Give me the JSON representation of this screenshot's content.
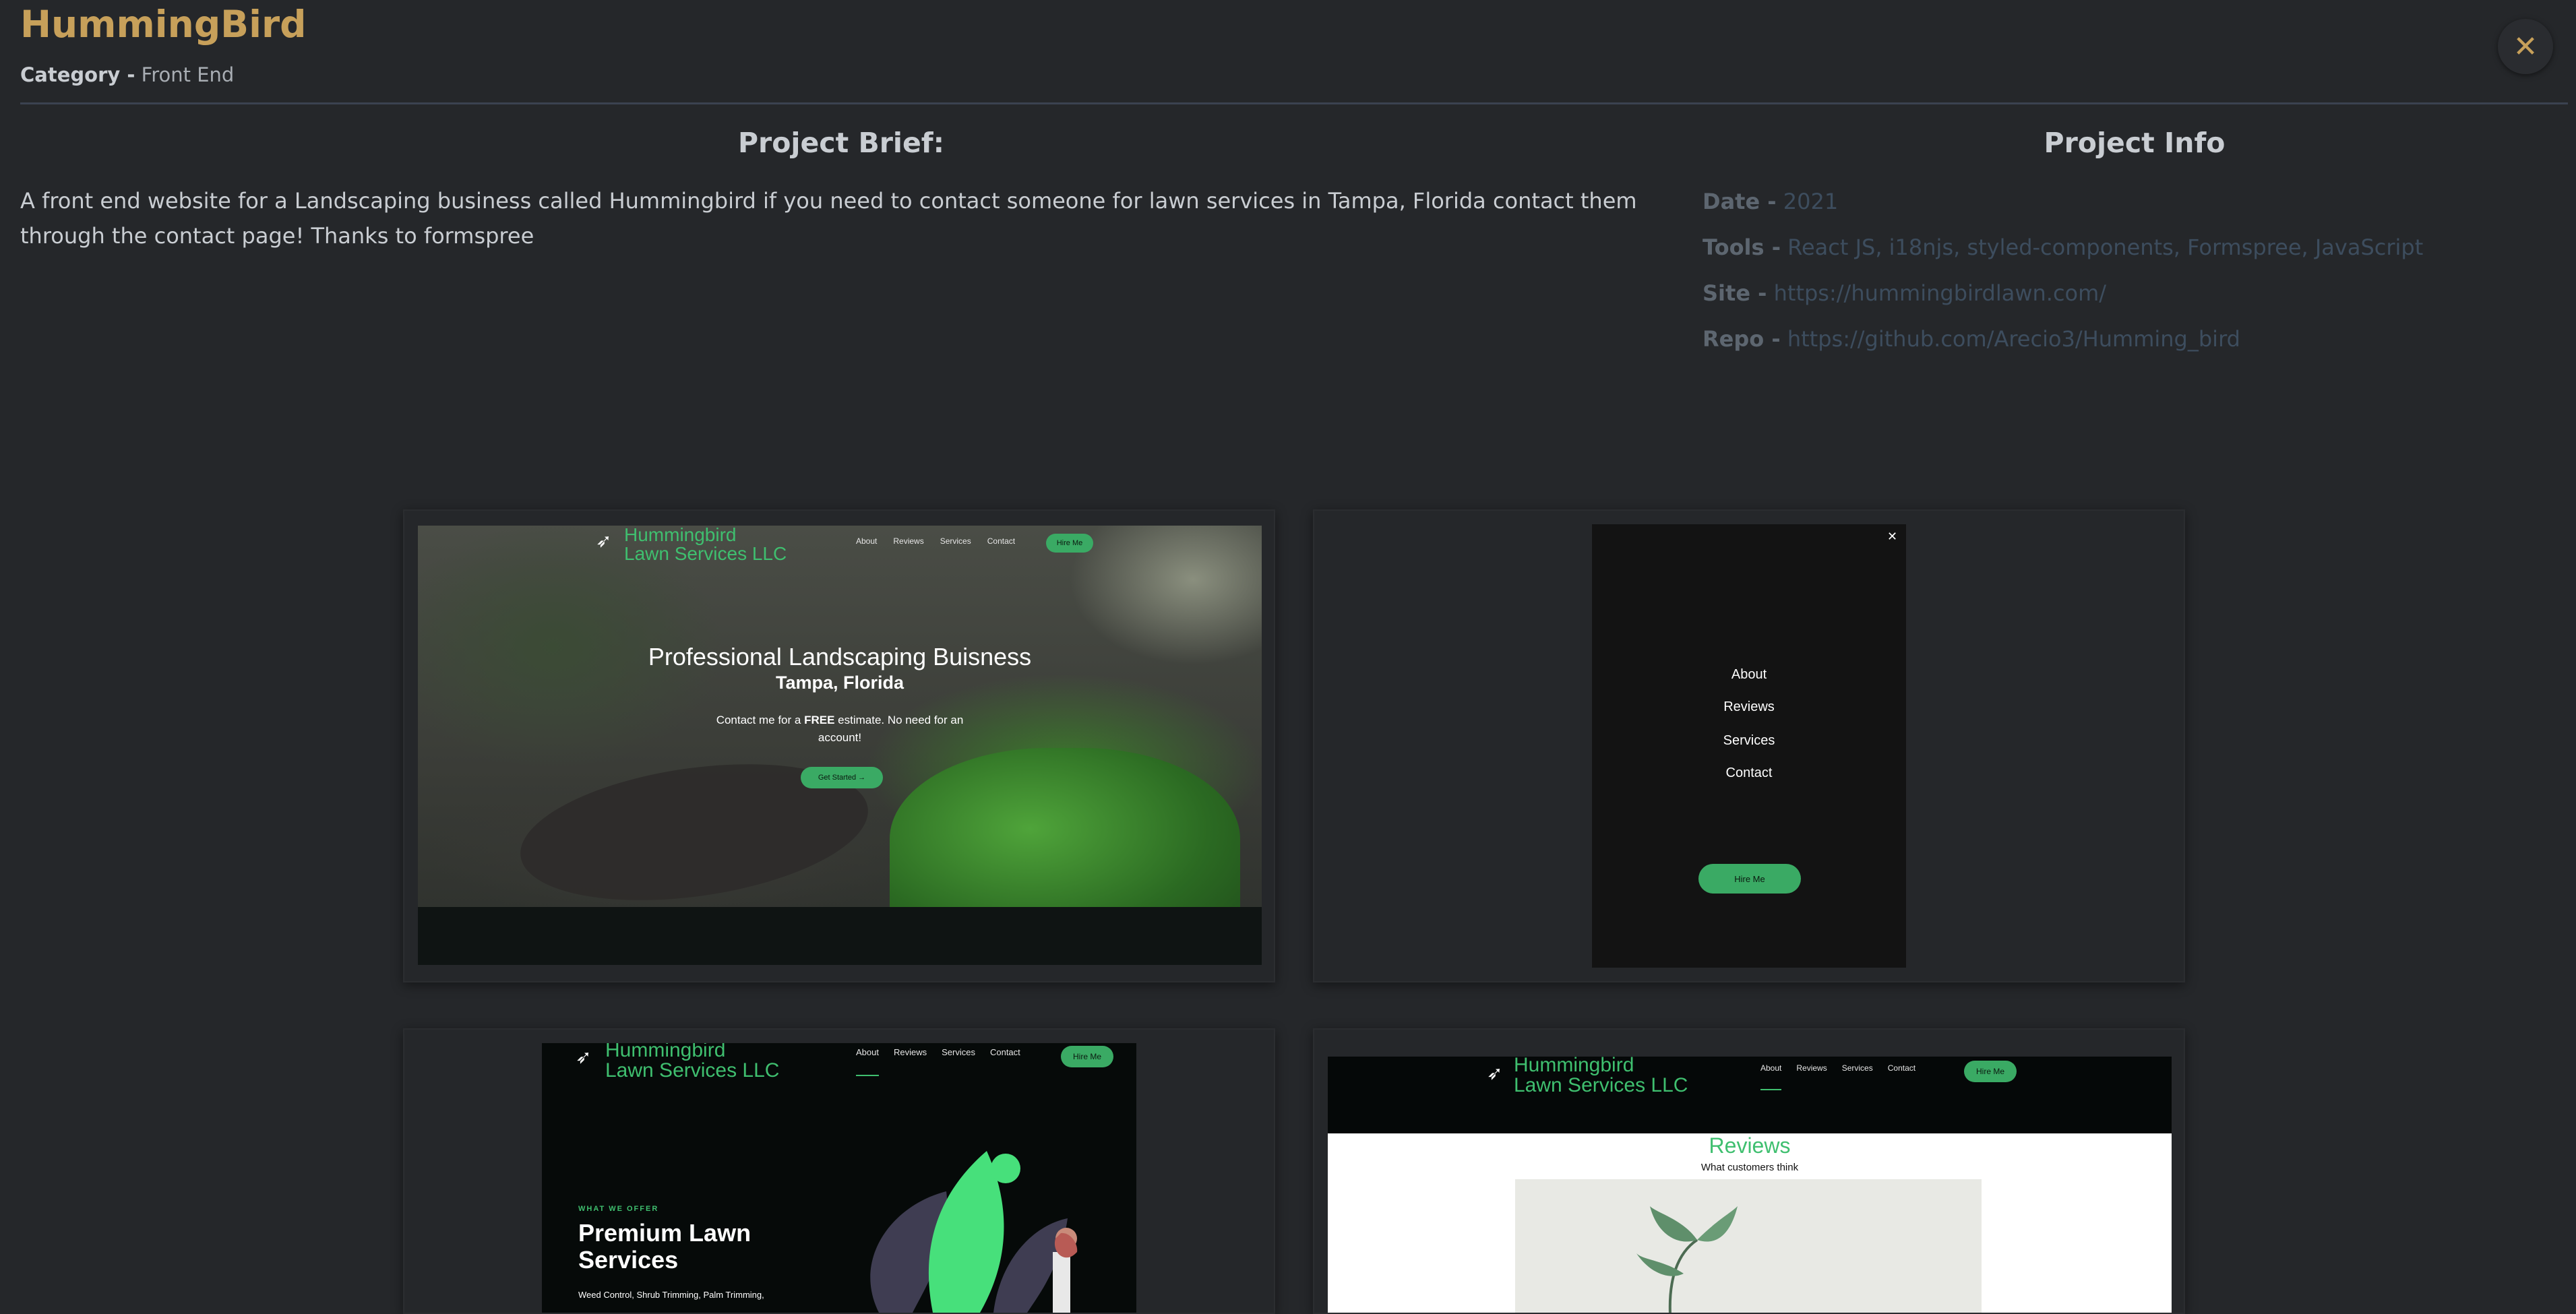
{
  "header": {
    "title": "HummingBird",
    "category_label": "Category -",
    "category_value": "Front End",
    "close_glyph": "✕"
  },
  "brief": {
    "heading": "Project Brief:",
    "text": "A front end website for a Landscaping business called Hummingbird if you need to contact someone for lawn services in Tampa, Florida contact them through the contact page! Thanks to formspree"
  },
  "info": {
    "heading": "Project Info",
    "date_label": "Date -",
    "date_value": "2021",
    "tools_label": "Tools -",
    "tools_value": "React JS, i18njs, styled-components, Formspree, JavaScript",
    "site_label": "Site -",
    "site_value": "https://hummingbirdlawn.com/",
    "repo_label": "Repo -",
    "repo_value": "https://github.com/Arecio3/Humming_bird"
  },
  "gallery": {
    "site": {
      "logo_line1": "Hummingbird",
      "logo_line2": "Lawn Services LLC",
      "nav": [
        "About",
        "Reviews",
        "Services",
        "Contact"
      ],
      "hire_button": "Hire Me"
    },
    "shot1": {
      "hero_title": "Professional Landscaping Buisness",
      "hero_sub": "Tampa, Florida",
      "hero_text_a": "Contact me for a ",
      "hero_text_bold": "FREE",
      "hero_text_b": " estimate. No need for an account!",
      "cta": "Get Started →"
    },
    "shot2": {
      "close_glyph": "✕",
      "menu": [
        "About",
        "Reviews",
        "Services",
        "Contact"
      ],
      "hire_button": "Hire Me"
    },
    "shot3": {
      "kicker": "WHAT WE OFFER",
      "title": "Premium Lawn Services",
      "text": "Weed Control, Shrub Trimming, Palm Trimming,"
    },
    "shot4": {
      "title": "Reviews",
      "subtitle": "What customers think"
    }
  },
  "colors": {
    "background": "#25272a",
    "accent_gold": "#c7a05a",
    "brand_green": "#3fbf6f",
    "link_muted": "#3d4d5e"
  }
}
